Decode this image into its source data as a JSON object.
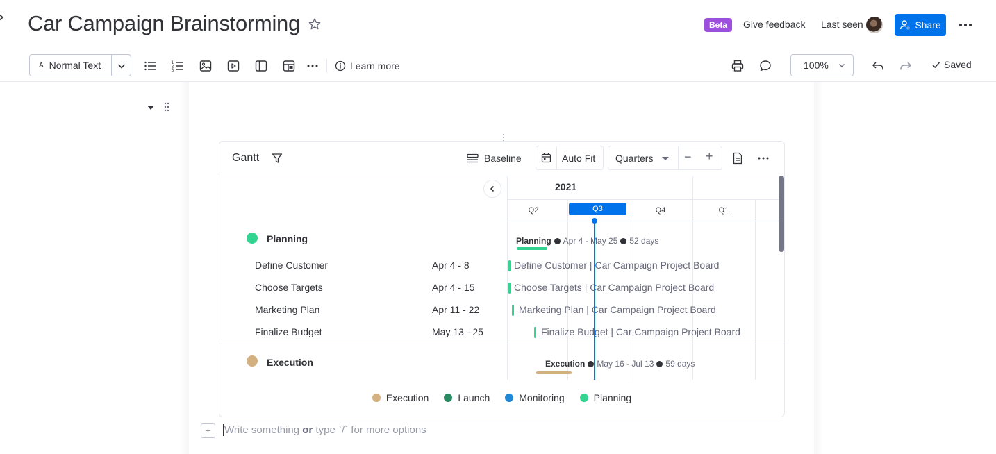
{
  "header": {
    "title": "Car Campaign Brainstorming",
    "beta_badge": "Beta",
    "give_feedback": "Give feedback",
    "last_seen": "Last seen",
    "share_label": "Share"
  },
  "toolbar": {
    "text_style_glyph": "A",
    "text_style": "Normal Text",
    "learn_more": "Learn more",
    "zoom": "100%",
    "saved": "Saved"
  },
  "gantt": {
    "title": "Gantt",
    "baseline_label": "Baseline",
    "autofit_label": "Auto Fit",
    "scale_label": "Quarters",
    "minus": "−",
    "plus": "+",
    "timeline": {
      "year": "2021",
      "quarters": [
        "Q2",
        "Q3",
        "Q4",
        "Q1"
      ],
      "current_quarter": "Q3"
    },
    "groups": [
      {
        "name": "Planning",
        "color": "#33d391",
        "range": "Apr 4 - May 25",
        "duration": "52 days",
        "tasks": [
          {
            "name": "Define Customer",
            "dates": "Apr 4 - 8",
            "bar_label": "Define Customer | Car Campaign Project Board"
          },
          {
            "name": "Choose Targets",
            "dates": "Apr 4 - 15",
            "bar_label": "Choose Targets | Car Campaign Project Board"
          },
          {
            "name": "Marketing Plan",
            "dates": "Apr 11 - 22",
            "bar_label": "Marketing Plan | Car Campaign Project Board"
          },
          {
            "name": "Finalize Budget",
            "dates": "May 13 - 25",
            "bar_label": "Finalize Budget | Car Campaign Project Board"
          }
        ]
      },
      {
        "name": "Execution",
        "color": "#d3b07f",
        "range": "May 16 - Jul 13",
        "duration": "59 days",
        "tasks": []
      }
    ],
    "legend": [
      {
        "label": "Execution",
        "color": "#d3b07f"
      },
      {
        "label": "Launch",
        "color": "#2b8a62"
      },
      {
        "label": "Monitoring",
        "color": "#1f87d6"
      },
      {
        "label": "Planning",
        "color": "#33d391"
      }
    ]
  },
  "editor": {
    "add_block": "+",
    "placeholder_pre": "Write something ",
    "placeholder_or": "or",
    "placeholder_post": " type `/` for more options"
  },
  "colors": {
    "accent": "#0073ea",
    "beta": "#9d50dd"
  },
  "icons": [
    "star-icon",
    "person-add-icon",
    "more-horizontal-icon",
    "chevron-down-icon",
    "bullet-list-icon",
    "numbered-list-icon",
    "image-icon",
    "video-icon",
    "layout-icon",
    "table-icon",
    "info-icon",
    "print-icon",
    "comment-icon",
    "undo-icon",
    "redo-icon",
    "check-icon",
    "filter-icon",
    "baseline-icon",
    "calendar-icon",
    "export-icon",
    "chevron-left-icon",
    "drag-handle-icon",
    "caret-down-icon"
  ]
}
